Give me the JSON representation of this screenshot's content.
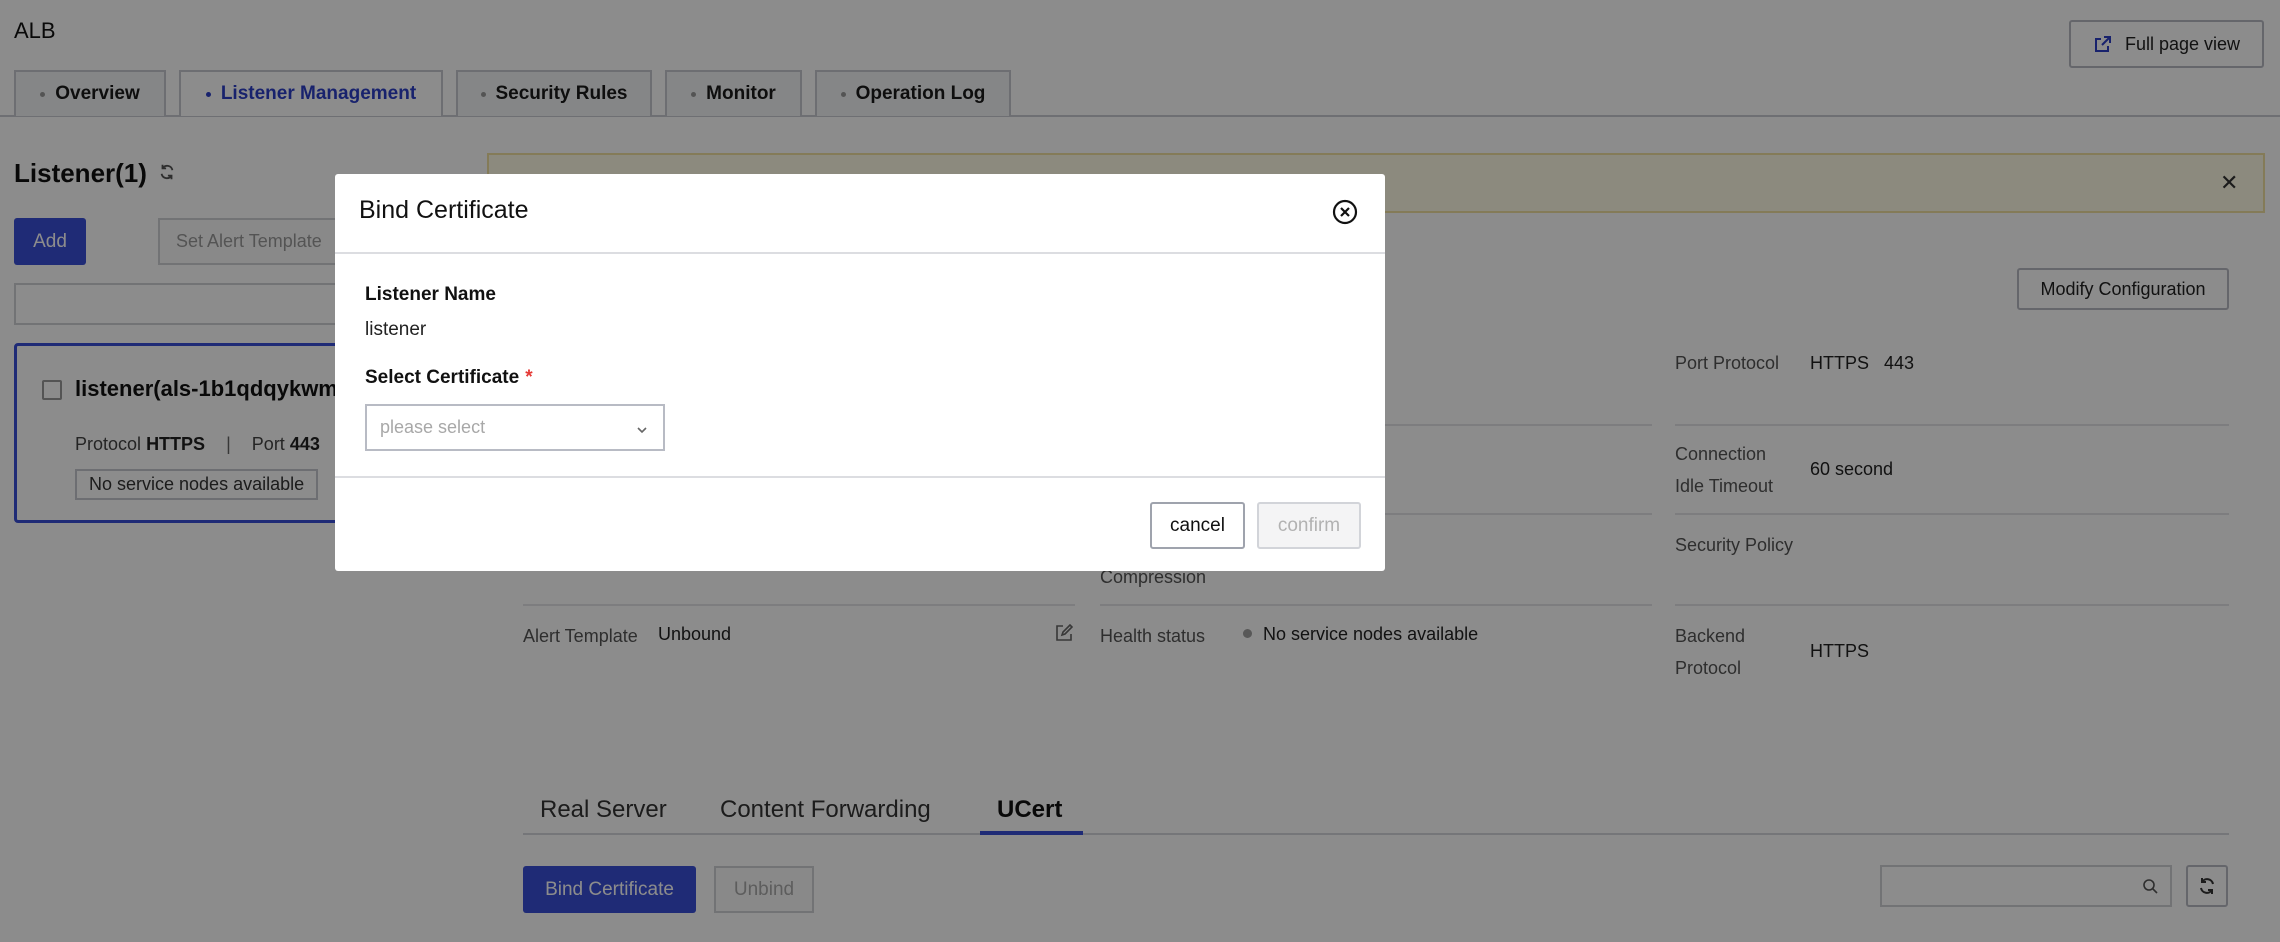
{
  "app": {
    "title": "ALB",
    "full_page_label": "Full page view"
  },
  "tabs": [
    {
      "label": "Overview"
    },
    {
      "label": "Listener Management",
      "active": true
    },
    {
      "label": "Security Rules"
    },
    {
      "label": "Monitor"
    },
    {
      "label": "Operation Log"
    }
  ],
  "listeners": {
    "title": "Listener(1)",
    "add_label": "Add",
    "alert_template_label": "Set Alert Template",
    "card": {
      "name": "listener(als-1b1qdqykwm",
      "protocol_label": "Protocol",
      "protocol": "HTTPS",
      "separator": "|",
      "port_label": "Port",
      "port": "443",
      "status": "No service nodes available"
    }
  },
  "detail": {
    "modify_label": "Modify Configuration",
    "port_protocol": {
      "label": "Port Protocol",
      "protocol": "HTTPS",
      "port": "443"
    },
    "idle_timeout": {
      "label_line1": "Connection",
      "label_line2": "Idle Timeout",
      "value": "60 second"
    },
    "security_policy": {
      "label": "Security Policy"
    },
    "compression": {
      "label": "Compression"
    },
    "alert_template": {
      "label": "Alert Template",
      "value": "Unbound"
    },
    "health_status": {
      "label": "Health status",
      "value": "No service nodes available"
    },
    "backend_protocol": {
      "label_line1": "Backend",
      "label_line2": "Protocol",
      "value": "HTTPS"
    }
  },
  "sub_tabs": [
    {
      "label": "Real Server"
    },
    {
      "label": "Content Forwarding"
    },
    {
      "label": "UCert",
      "active": true
    }
  ],
  "ucert": {
    "bind_label": "Bind Certificate",
    "unbind_label": "Unbind"
  },
  "modal": {
    "title": "Bind Certificate",
    "listener_name_label": "Listener Name",
    "listener_name_value": "listener",
    "select_label": "Select Certificate",
    "required_mark": "*",
    "select_placeholder": "please select",
    "cancel_label": "cancel",
    "confirm_label": "confirm"
  },
  "colors": {
    "accent": "#3a4fd8",
    "warning_bg": "#fffbe6",
    "required": "#e53935",
    "overlay": "rgba(0,0,0,0.45)"
  },
  "icons": [
    "external-link-icon",
    "refresh-icon",
    "close-icon",
    "edit-icon",
    "search-icon",
    "chevron-down-icon",
    "close-circle-icon"
  ]
}
